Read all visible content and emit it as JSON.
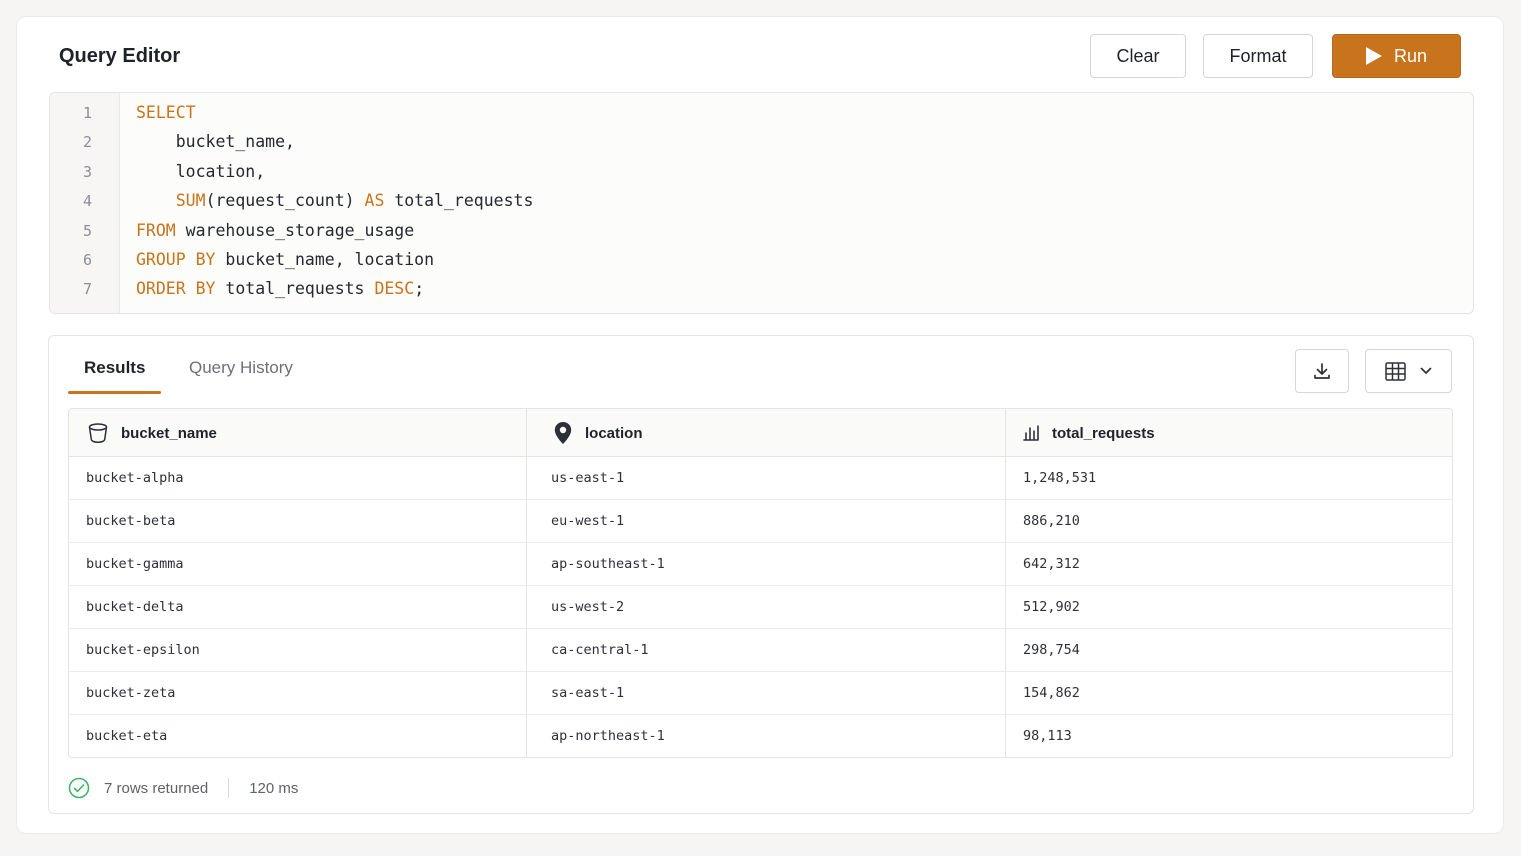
{
  "header": {
    "title": "Query Editor",
    "clear_label": "Clear",
    "format_label": "Format",
    "run_label": "Run"
  },
  "editor": {
    "line_numbers": [
      "1",
      "2",
      "3",
      "4",
      "5",
      "6",
      "7"
    ],
    "lines": [
      [
        {
          "t": "SELECT",
          "k": true
        }
      ],
      [
        {
          "t": "    bucket_name,",
          "k": false
        }
      ],
      [
        {
          "t": "    location,",
          "k": false
        }
      ],
      [
        {
          "t": "    ",
          "k": false
        },
        {
          "t": "SUM",
          "k": true
        },
        {
          "t": "(request_count) ",
          "k": false
        },
        {
          "t": "AS",
          "k": true
        },
        {
          "t": " total_requests",
          "k": false
        }
      ],
      [
        {
          "t": "FROM",
          "k": true
        },
        {
          "t": " warehouse_storage_usage",
          "k": false
        }
      ],
      [
        {
          "t": "GROUP BY",
          "k": true
        },
        {
          "t": " bucket_name, location",
          "k": false
        }
      ],
      [
        {
          "t": "ORDER BY",
          "k": true
        },
        {
          "t": " total_requests ",
          "k": false
        },
        {
          "t": "DESC",
          "k": true
        },
        {
          "t": ";",
          "k": false
        }
      ]
    ]
  },
  "results": {
    "tabs": {
      "results": "Results",
      "history": "Query History"
    },
    "columns": {
      "bucket": "bucket_name",
      "location": "location",
      "requests": "total_requests"
    },
    "rows": [
      [
        "bucket-alpha",
        "us-east-1",
        "1,248,531"
      ],
      [
        "bucket-beta",
        "eu-west-1",
        "886,210"
      ],
      [
        "bucket-gamma",
        "ap-southeast-1",
        "642,312"
      ],
      [
        "bucket-delta",
        "us-west-2",
        "512,902"
      ],
      [
        "bucket-epsilon",
        "ca-central-1",
        "298,754"
      ],
      [
        "bucket-zeta",
        "sa-east-1",
        "154,862"
      ],
      [
        "bucket-eta",
        "ap-northeast-1",
        "98,113"
      ]
    ],
    "footer": {
      "rows_returned": "7 rows returned",
      "duration": "120 ms"
    }
  },
  "icons": {
    "run": "play-icon",
    "download": "download-icon",
    "view": "table-grid-icon",
    "dropdown": "chevron-down-icon",
    "bucket": "bucket-icon",
    "location": "map-pin-icon",
    "requests": "bar-chart-icon",
    "success": "check-circle-icon"
  },
  "colors": {
    "accent": "#c7741c",
    "keyword": "#c7741c",
    "success": "#3fb36b"
  }
}
